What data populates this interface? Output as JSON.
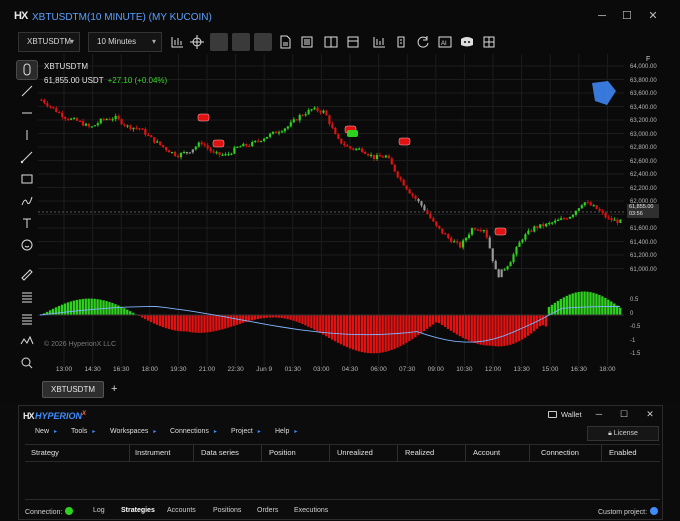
{
  "window": {
    "logo": "HX",
    "title": "XBTUSDTM(10 MINUTE) (MY KUCOIN)"
  },
  "toolbar": {
    "instrument": "XBTUSDTM",
    "interval": "10 Minutes"
  },
  "chart": {
    "symbol": "XBTUSDTM",
    "price": "61,855.00 USDT",
    "change": "+27.10 (+0.04%)",
    "copyright": "© 2026 HyperionX LLC",
    "last_price_label": "61,855.00",
    "last_price_countdown": "03:56",
    "f_marker": "F",
    "y_axis_labels": [
      "64,000.00",
      "63,800.00",
      "63,600.00",
      "63,400.00",
      "63,200.00",
      "63,000.00",
      "62,800.00",
      "62,600.00",
      "62,400.00",
      "62,200.00",
      "62,000.00",
      "61,600.00",
      "61,400.00",
      "61,200.00",
      "61,000.00"
    ],
    "osc_axis_labels": [
      "0.5",
      "0",
      "-0.5",
      "-1",
      "-1.5"
    ],
    "x_axis_labels": [
      "13:00",
      "14:30",
      "16:30",
      "18:00",
      "19:30",
      "21:00",
      "22:30",
      "Jun 9",
      "01:30",
      "03:00",
      "04:30",
      "06:00",
      "07:30",
      "09:00",
      "10:30",
      "12:00",
      "13:30",
      "15:00",
      "16:30",
      "18:00"
    ],
    "colors": {
      "up": "#2fd11f",
      "down": "#e01212",
      "flat": "#9a9a9a",
      "signal": "#7fb4ff",
      "accent": "#3f8cff"
    }
  },
  "chart_data": {
    "type": "candlestick",
    "series_close_approx": [
      63550,
      63420,
      63300,
      63250,
      63160,
      63280,
      63300,
      63180,
      63150,
      63000,
      62880,
      62780,
      62840,
      62960,
      62800,
      62780,
      62900,
      62930,
      63020,
      63100,
      63180,
      63330,
      63420,
      63380,
      63000,
      62880,
      62860,
      62750,
      62770,
      62480,
      62250,
      62060,
      61800,
      61640,
      61520,
      61780,
      61760,
      61100,
      61300,
      61630,
      61780,
      61820,
      61880,
      61950,
      62140,
      62050,
      61900,
      61860
    ],
    "ylim": [
      61000,
      64100
    ],
    "oscillator": {
      "range": [
        -1.5,
        0.5
      ]
    }
  },
  "tabs": [
    {
      "label": "XBTUSDTM"
    }
  ],
  "tab_add": "+",
  "control_center": {
    "logo": "HX",
    "brand": "HYPERION",
    "brand_sup": "X",
    "wallet": "Wallet",
    "license": "License",
    "menu": [
      "New",
      "Tools",
      "Workspaces",
      "Connections",
      "Project",
      "Help"
    ],
    "columns": [
      "Strategy",
      "Instrument",
      "Data series",
      "Position",
      "Unrealized",
      "Realized",
      "Account",
      "Connection",
      "Enabled"
    ],
    "status": {
      "connection": "Connection:",
      "tabs": [
        "Log",
        "Strategies",
        "Accounts",
        "Positions",
        "Orders",
        "Executions"
      ],
      "active_tab": "Strategies",
      "custom_project": "Custom project:"
    }
  }
}
